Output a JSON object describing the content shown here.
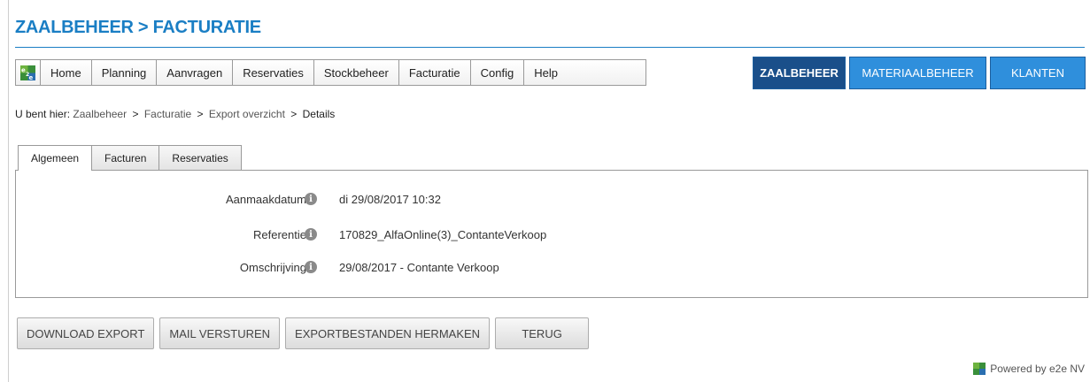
{
  "header": {
    "title": "ZAALBEHEER > FACTURATIE"
  },
  "menu": {
    "logo_icon": "e2e-logo-icon",
    "items": [
      {
        "label": "Home"
      },
      {
        "label": "Planning"
      },
      {
        "label": "Aanvragen"
      },
      {
        "label": "Reservaties"
      },
      {
        "label": "Stockbeheer"
      },
      {
        "label": "Facturatie"
      },
      {
        "label": "Config"
      },
      {
        "label": "Help"
      }
    ]
  },
  "modules": {
    "zaalbeheer": "ZAALBEHEER",
    "materiaalbeheer": "MATERIAALBEHEER",
    "klanten": "KLANTEN",
    "active_color": "#1a4f8a",
    "color": "#2f8fdc"
  },
  "breadcrumb": {
    "prefix": "U bent hier:",
    "items": [
      "Zaalbeheer",
      "Facturatie",
      "Export overzicht",
      "Details"
    ],
    "separator": ">"
  },
  "tabs": [
    {
      "label": "Algemeen",
      "active": true
    },
    {
      "label": "Facturen",
      "active": false
    },
    {
      "label": "Reservaties",
      "active": false
    }
  ],
  "details": [
    {
      "label": "Aanmaakdatum",
      "value": "di 29/08/2017 10:32",
      "icon": "info-icon"
    },
    {
      "label": "Referentie",
      "value": "170829_AlfaOnline(3)_ContanteVerkoop",
      "icon": "info-icon"
    },
    {
      "label": "Omschrijving",
      "value": "29/08/2017 - Contante Verkoop",
      "icon": "info-icon"
    }
  ],
  "actions": {
    "download": "DOWNLOAD EXPORT",
    "mail": "MAIL VERSTUREN",
    "rebuild": "EXPORTBESTANDEN HERMAKEN",
    "back": "TERUG"
  },
  "footer": {
    "powered": "Powered by e2e NV"
  },
  "colors": {
    "brand": "#1a7ec4"
  }
}
